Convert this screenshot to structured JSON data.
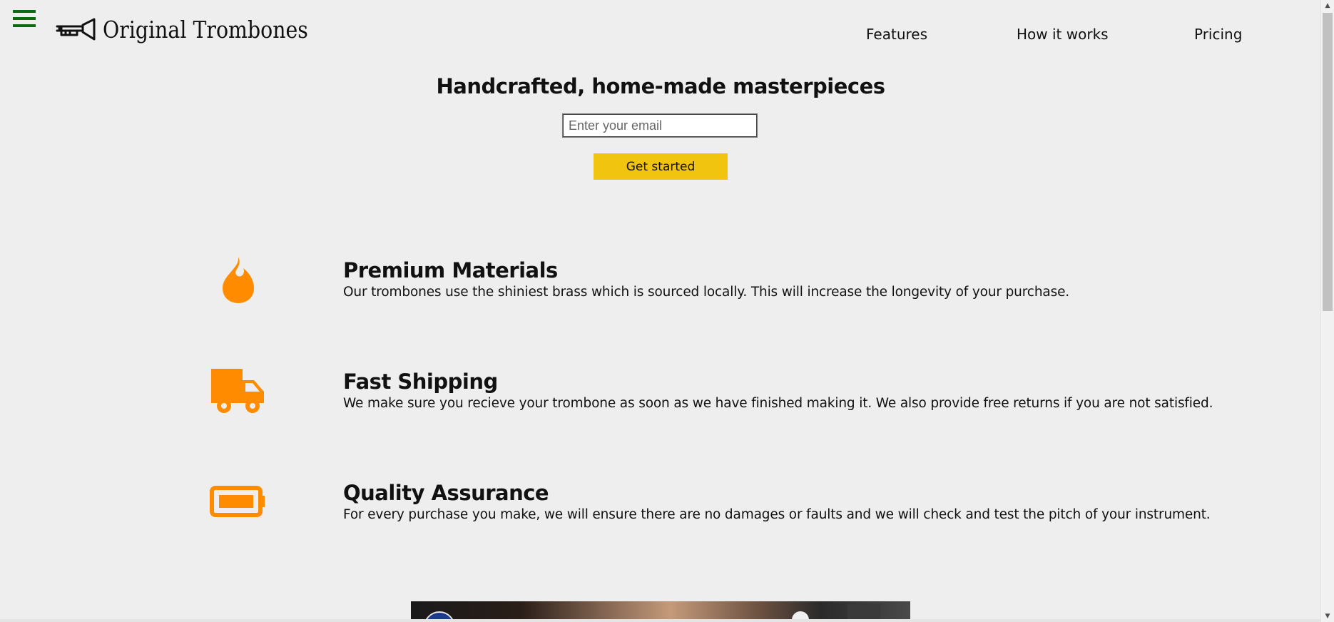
{
  "header": {
    "menu_icon": "hamburger-menu-icon",
    "brand_logo_icon": "trombone-icon",
    "brand_name": "Original Trombones",
    "nav": [
      {
        "label": "Features"
      },
      {
        "label": "How it works"
      },
      {
        "label": "Pricing"
      }
    ]
  },
  "hero": {
    "title": "Handcrafted, home-made masterpieces",
    "email_placeholder": "Enter your email",
    "cta_label": "Get started"
  },
  "features": [
    {
      "icon": "flame-icon",
      "title": "Premium Materials",
      "text": "Our trombones use the shiniest brass which is sourced locally. This will increase the longevity of your purchase."
    },
    {
      "icon": "truck-icon",
      "title": "Fast Shipping",
      "text": "We make sure you recieve your trombone as soon as we have finished making it. We also provide free returns if you are not satisfied."
    },
    {
      "icon": "battery-icon",
      "title": "Quality Assurance",
      "text": "For every purchase you make, we will ensure there are no damages or faults and we will check and test the pitch of your instrument."
    }
  ],
  "colors": {
    "accent": "#f1c40f",
    "icon": "#ff8c00",
    "menu": "#0b6b10",
    "background": "#eeeeee"
  }
}
